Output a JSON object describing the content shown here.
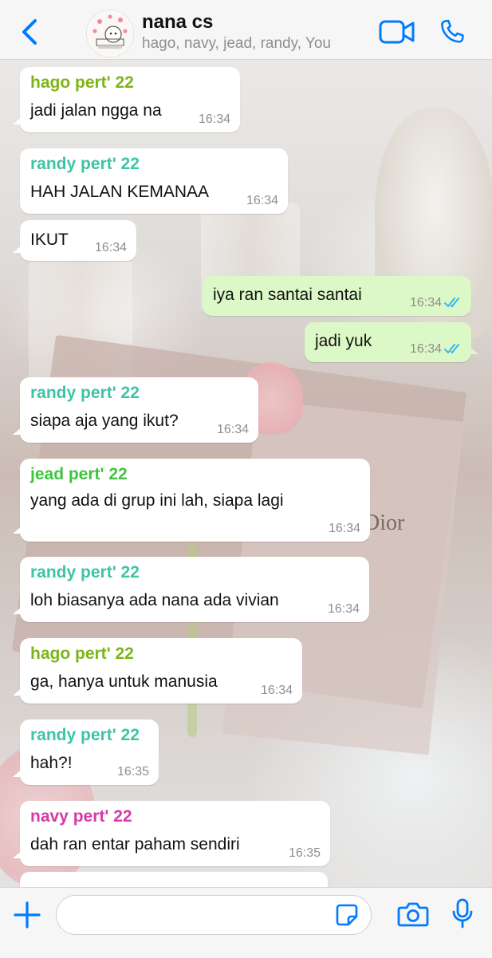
{
  "colors": {
    "accent": "#007aff",
    "outgoing_bubble": "#dcf8c6",
    "incoming_bubble": "#ffffff",
    "tick_read": "#34b7f1"
  },
  "header": {
    "title": "nana cs",
    "members": "hago, navy, jead, randy, You",
    "avatar_icon": "group-avatar",
    "back_icon": "chevron-left-icon",
    "video_icon": "video-camera-icon",
    "call_icon": "phone-icon"
  },
  "wallpaper": {
    "book_text": "Dior"
  },
  "messages": [
    {
      "sender": "hago pert' 22",
      "sender_color": "#7cb518",
      "text": "jadi jalan ngga na",
      "time": "16:34",
      "direction": "in"
    },
    {
      "sender": "randy pert' 22",
      "sender_color": "#3cc5a5",
      "text": "HAH JALAN KEMANAA",
      "time": "16:34",
      "direction": "in"
    },
    {
      "sender": "",
      "text": "IKUT",
      "time": "16:34",
      "direction": "in"
    },
    {
      "text": "iya ran santai santai",
      "time": "16:34",
      "direction": "out",
      "status": "read"
    },
    {
      "text": "jadi yuk",
      "time": "16:34",
      "direction": "out",
      "status": "read"
    },
    {
      "sender": "randy pert' 22",
      "sender_color": "#3cc5a5",
      "text": "siapa aja yang ikut?",
      "time": "16:34",
      "direction": "in"
    },
    {
      "sender": "jead pert' 22",
      "sender_color": "#3ec43e",
      "text": "yang ada di grup ini lah, siapa lagi",
      "time": "16:34",
      "direction": "in"
    },
    {
      "sender": "randy pert' 22",
      "sender_color": "#3cc5a5",
      "text": "loh biasanya ada nana ada vivian",
      "time": "16:34",
      "direction": "in"
    },
    {
      "sender": "hago pert' 22",
      "sender_color": "#7cb518",
      "text": "ga, hanya untuk manusia",
      "time": "16:34",
      "direction": "in"
    },
    {
      "sender": "randy pert' 22",
      "sender_color": "#3cc5a5",
      "text": "hah?!",
      "time": "16:35",
      "direction": "in"
    },
    {
      "sender": "navy pert' 22",
      "sender_color": "#d63aa4",
      "text": "dah ran entar paham sendiri",
      "time": "16:35",
      "direction": "in"
    }
  ],
  "composer": {
    "value": "",
    "placeholder": "",
    "plus_icon": "plus-icon",
    "sticker_icon": "sticker-icon",
    "camera_icon": "camera-icon",
    "mic_icon": "microphone-icon"
  }
}
